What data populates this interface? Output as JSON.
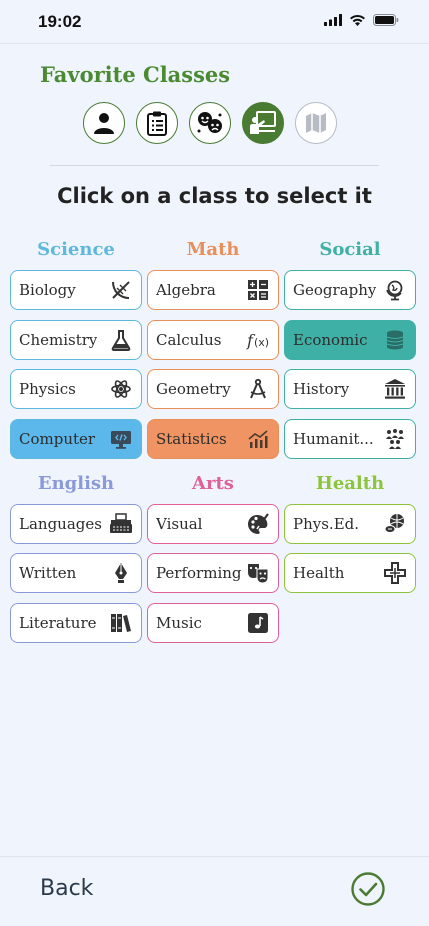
{
  "status": {
    "time": "19:02"
  },
  "header": {
    "title": "Favorite Classes"
  },
  "steps": [
    {
      "icon": "person-icon",
      "state": "done"
    },
    {
      "icon": "clipboard-icon",
      "state": "done"
    },
    {
      "icon": "theater-masks-icon",
      "state": "done"
    },
    {
      "icon": "teacher-board-icon",
      "state": "active"
    },
    {
      "icon": "map-icon",
      "state": "disabled"
    }
  ],
  "instruction": "Click on a class to select it",
  "columns": {
    "science": {
      "title": "Science",
      "color": "#5cb8dc"
    },
    "math": {
      "title": "Math",
      "color": "#e9905a"
    },
    "social": {
      "title": "Social",
      "color": "#3fb0a6"
    },
    "english": {
      "title": "English",
      "color": "#8a9ad8"
    },
    "arts": {
      "title": "Arts",
      "color": "#e0609a"
    },
    "health": {
      "title": "Health",
      "color": "#8cc43c"
    }
  },
  "classes": {
    "biology": {
      "label": "Biology",
      "icon": "dna-icon",
      "selected": false
    },
    "chemistry": {
      "label": "Chemistry",
      "icon": "flask-icon",
      "selected": false
    },
    "physics": {
      "label": "Physics",
      "icon": "atom-icon",
      "selected": false
    },
    "computer": {
      "label": "Computer",
      "icon": "code-monitor-icon",
      "selected": true
    },
    "algebra": {
      "label": "Algebra",
      "icon": "calculator-icon",
      "selected": false
    },
    "calculus": {
      "label": "Calculus",
      "icon": "function-icon",
      "selected": false
    },
    "geometry": {
      "label": "Geometry",
      "icon": "compass-icon",
      "selected": false
    },
    "statistics": {
      "label": "Statistics",
      "icon": "chart-icon",
      "selected": true
    },
    "geography": {
      "label": "Geography",
      "icon": "globe-icon",
      "selected": false
    },
    "economic": {
      "label": "Economic",
      "icon": "coins-icon",
      "selected": true
    },
    "history": {
      "label": "History",
      "icon": "museum-icon",
      "selected": false
    },
    "humanities": {
      "label": "Humanit...",
      "icon": "people-icon",
      "selected": false
    },
    "languages": {
      "label": "Languages",
      "icon": "typewriter-icon",
      "selected": false
    },
    "written": {
      "label": "Written",
      "icon": "pen-nib-icon",
      "selected": false
    },
    "literature": {
      "label": "Literature",
      "icon": "books-icon",
      "selected": false
    },
    "visual": {
      "label": "Visual",
      "icon": "palette-icon",
      "selected": false
    },
    "performing": {
      "label": "Performing",
      "icon": "theater-masks-icon",
      "selected": false
    },
    "music": {
      "label": "Music",
      "icon": "music-note-icon",
      "selected": false
    },
    "physed": {
      "label": "Phys.Ed.",
      "icon": "sports-balls-icon",
      "selected": false
    },
    "health": {
      "label": "Health",
      "icon": "medical-cross-icon",
      "selected": false
    }
  },
  "footer": {
    "back_label": "Back",
    "confirm_icon": "check-circle-icon",
    "accent": "#4a7b33"
  }
}
